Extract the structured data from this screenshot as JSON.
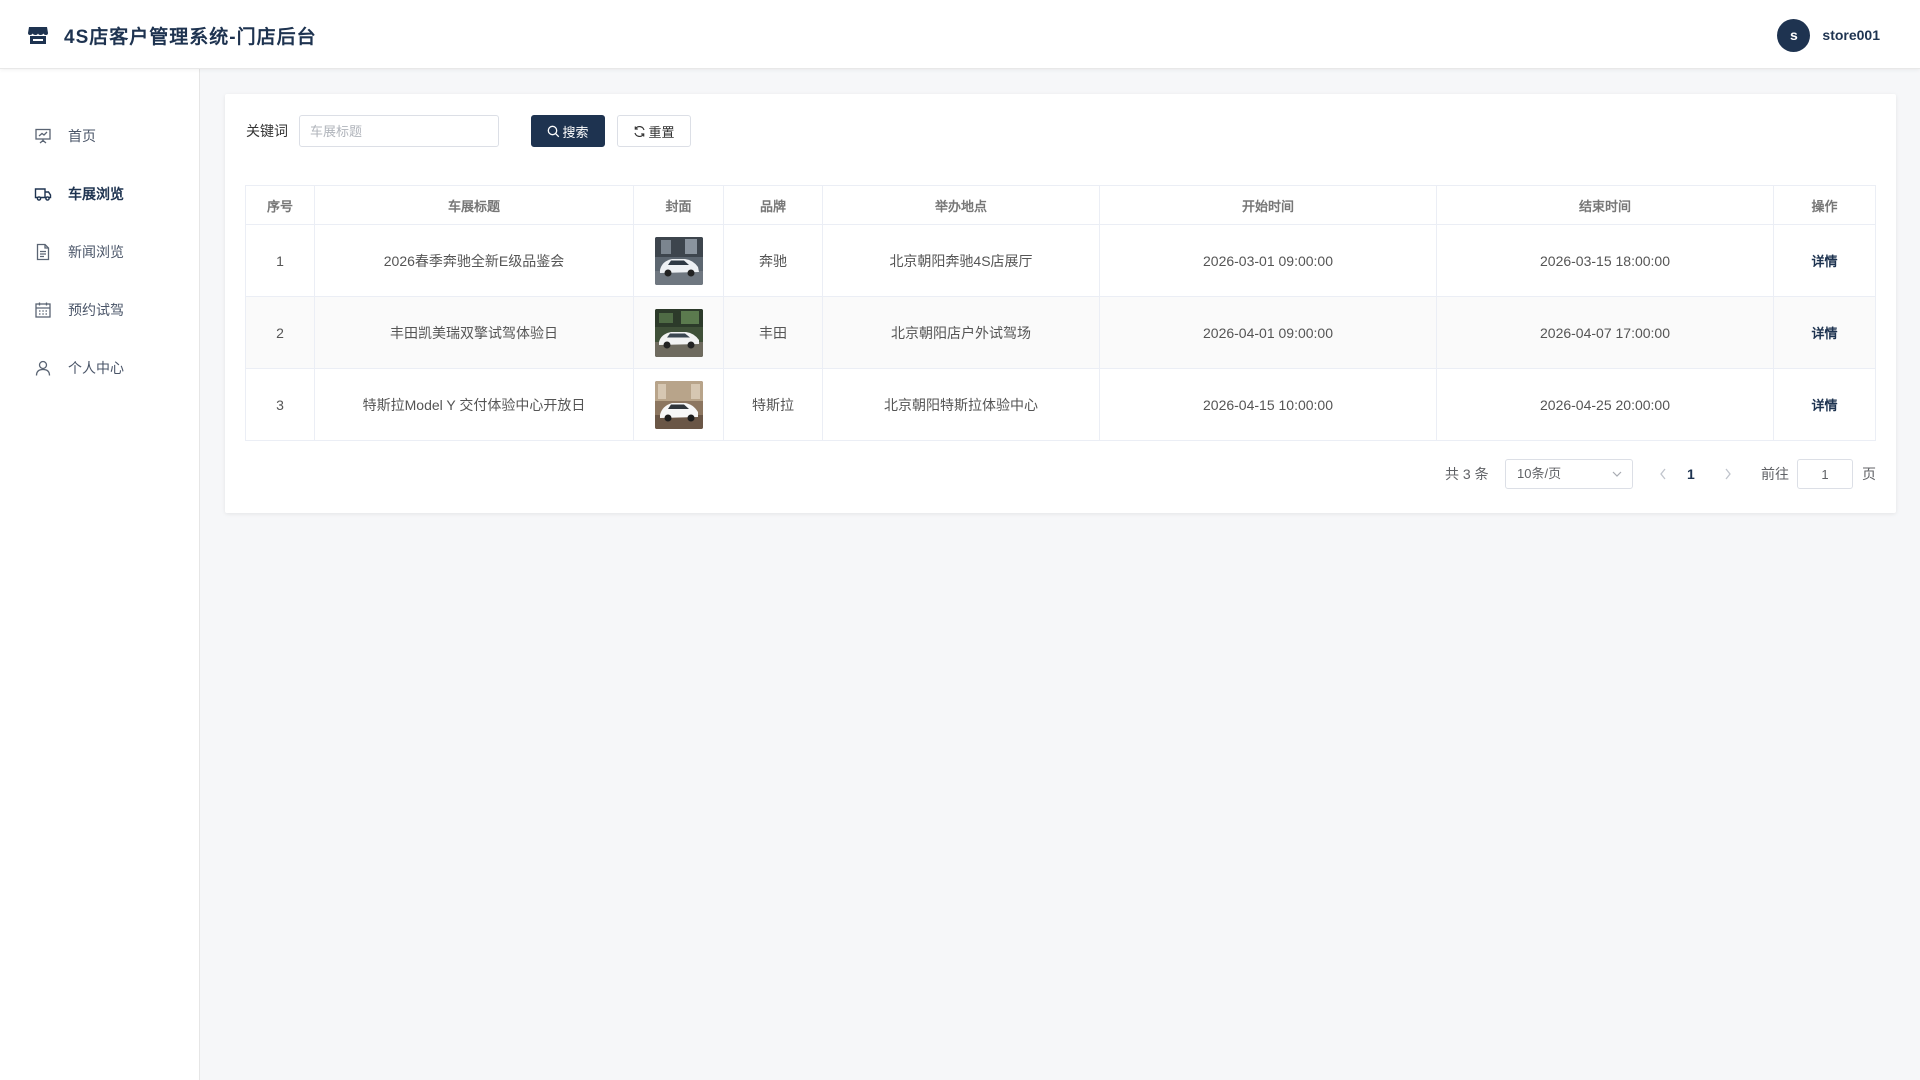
{
  "header": {
    "title": "4S店客户管理系统-门店后台",
    "avatar_letter": "s",
    "username": "store001",
    "logo_icon": "storefront-icon"
  },
  "sidebar": {
    "items": [
      {
        "label": "首页",
        "icon": "presentation-icon",
        "active": false
      },
      {
        "label": "车展浏览",
        "icon": "truck-icon",
        "active": true
      },
      {
        "label": "新闻浏览",
        "icon": "document-icon",
        "active": false
      },
      {
        "label": "预约试驾",
        "icon": "calendar-icon",
        "active": false
      },
      {
        "label": "个人中心",
        "icon": "user-icon",
        "active": false
      }
    ]
  },
  "search": {
    "label": "关键词",
    "placeholder": "车展标题",
    "value": "",
    "search_button": "搜索",
    "reset_button": "重置"
  },
  "table": {
    "headers": [
      "序号",
      "车展标题",
      "封面",
      "品牌",
      "举办地点",
      "开始时间",
      "结束时间",
      "操作"
    ],
    "rows": [
      {
        "index": "1",
        "title": "2026春季奔驰全新E级品鉴会",
        "brand": "奔驰",
        "location": "北京朝阳奔驰4S店展厅",
        "start": "2026-03-01 09:00:00",
        "end": "2026-03-15 18:00:00",
        "action": "详情"
      },
      {
        "index": "2",
        "title": "丰田凯美瑞双擎试驾体验日",
        "brand": "丰田",
        "location": "北京朝阳店户外试驾场",
        "start": "2026-04-01 09:00:00",
        "end": "2026-04-07 17:00:00",
        "action": "详情"
      },
      {
        "index": "3",
        "title": "特斯拉Model Y 交付体验中心开放日",
        "brand": "特斯拉",
        "location": "北京朝阳特斯拉体验中心",
        "start": "2026-04-15 10:00:00",
        "end": "2026-04-25 20:00:00",
        "action": "详情"
      }
    ]
  },
  "pagination": {
    "total": "共 3 条",
    "page_size": "10条/页",
    "current_page": "1",
    "goto_label": "前往",
    "goto_value": "1",
    "page_unit": "页"
  },
  "colors": {
    "primary": "#1e3350",
    "background": "#f6f7f9",
    "border": "#ebeef5"
  }
}
